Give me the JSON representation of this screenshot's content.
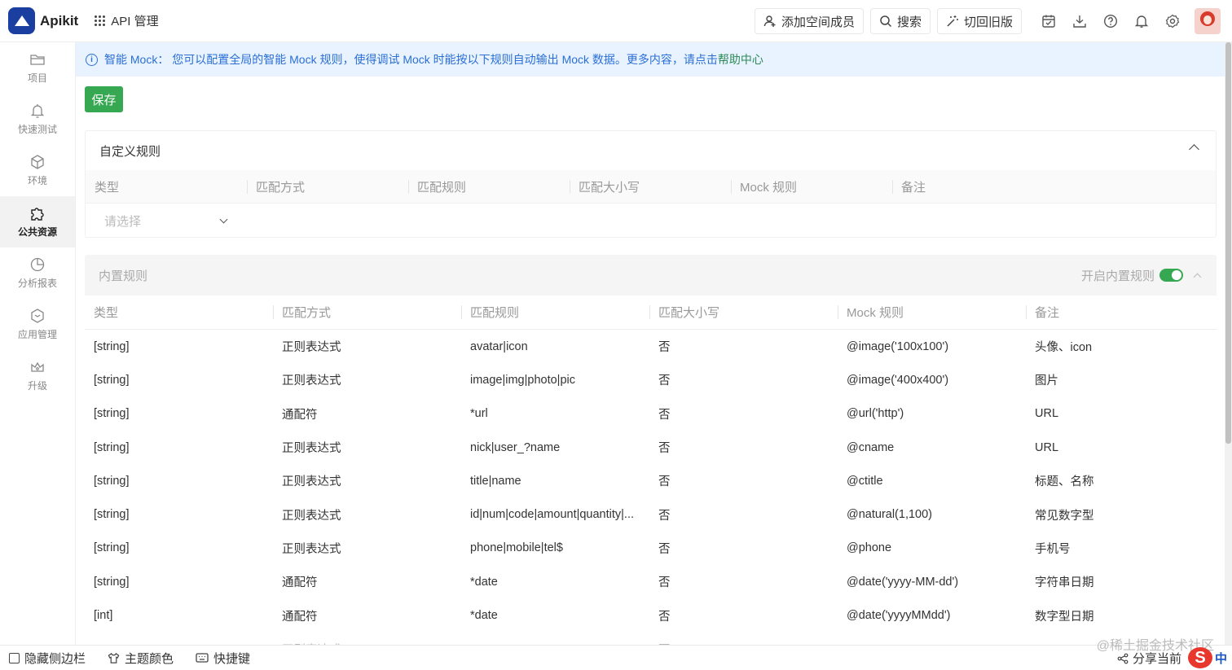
{
  "header": {
    "logo_text": "Apikit",
    "api_menu": "API 管理",
    "buttons": {
      "add_member": "添加空间成员",
      "search": "搜索",
      "switch_old": "切回旧版"
    }
  },
  "sidebar": {
    "items": [
      {
        "label": "项目",
        "icon": "folder-icon"
      },
      {
        "label": "快速测试",
        "icon": "bell-icon"
      },
      {
        "label": "环境",
        "icon": "cube-icon"
      },
      {
        "label": "公共资源",
        "icon": "puzzle-icon",
        "active": true
      },
      {
        "label": "分析报表",
        "icon": "pie-chart-icon"
      },
      {
        "label": "应用管理",
        "icon": "hexagon-icon"
      },
      {
        "label": "升级",
        "icon": "crown-icon"
      }
    ]
  },
  "notice": {
    "text": "智能 Mock： 您可以配置全局的智能 Mock 规则，使得调试 Mock 时能按以下规则自动输出 Mock 数据。更多内容，请点击",
    "link": "帮助中心"
  },
  "save_label": "保存",
  "custom_rules": {
    "title": "自定义规则",
    "columns": [
      "类型",
      "匹配方式",
      "匹配规则",
      "匹配大小写",
      "Mock 规则",
      "备注"
    ],
    "select_placeholder": "请选择"
  },
  "builtin_rules": {
    "title": "内置规则",
    "toggle_label": "开启内置规则",
    "toggle_on": true,
    "columns": [
      "类型",
      "匹配方式",
      "匹配规则",
      "匹配大小写",
      "Mock 规则",
      "备注"
    ],
    "rows": [
      [
        "[string]",
        "正则表达式",
        "avatar|icon",
        "否",
        "@image('100x100')",
        "头像、icon"
      ],
      [
        "[string]",
        "正则表达式",
        "image|img|photo|pic",
        "否",
        "@image('400x400')",
        "图片"
      ],
      [
        "[string]",
        "通配符",
        "*url",
        "否",
        "@url('http')",
        "URL"
      ],
      [
        "[string]",
        "正则表达式",
        "nick|user_?name",
        "否",
        "@cname",
        "URL"
      ],
      [
        "[string]",
        "正则表达式",
        "title|name",
        "否",
        "@ctitle",
        "标题、名称"
      ],
      [
        "[string]",
        "正则表达式",
        "id|num|code|amount|quantity|...",
        "否",
        "@natural(1,100)",
        "常见数字型"
      ],
      [
        "[string]",
        "正则表达式",
        "phone|mobile|tel$",
        "否",
        "@phone",
        "手机号"
      ],
      [
        "[string]",
        "通配符",
        "*date",
        "否",
        "@date('yyyy-MM-dd')",
        "字符串日期"
      ],
      [
        "[int]",
        "通配符",
        "*date",
        "否",
        "@date('yyyyMMdd')",
        "数字型日期"
      ],
      [
        "",
        "正则表达式",
        "",
        "否",
        "",
        ""
      ]
    ]
  },
  "footer": {
    "hide_sidebar": "隐藏侧边栏",
    "theme_color": "主题颜色",
    "shortcuts": "快捷键",
    "share": "分享当前",
    "watermark": "@稀土掘金技术社区",
    "ime": "中"
  }
}
